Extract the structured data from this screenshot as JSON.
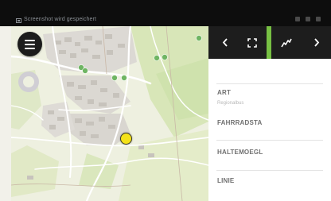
{
  "status_bar": {
    "notification_text": "Screenshot wird gespeichert",
    "notification_icon": "screenshot-icon"
  },
  "map": {
    "menu_icon": "hamburger-menu-icon",
    "location_marker_color": "#f4e21a",
    "stop_marker_color": "#6fb563"
  },
  "toolbar": {
    "icons": [
      "chevron-left-icon",
      "fullscreen-icon",
      "signal-icon",
      "chevron-right-icon"
    ],
    "accent_color": "#77c043"
  },
  "panel": {
    "fields": [
      {
        "label": "ART",
        "value": "Regionalbus"
      },
      {
        "label": "FAHRRADSTA",
        "value": ""
      },
      {
        "label": "HALTEMOEGL",
        "value": ""
      },
      {
        "label": "LINIE",
        "value": ""
      }
    ]
  }
}
